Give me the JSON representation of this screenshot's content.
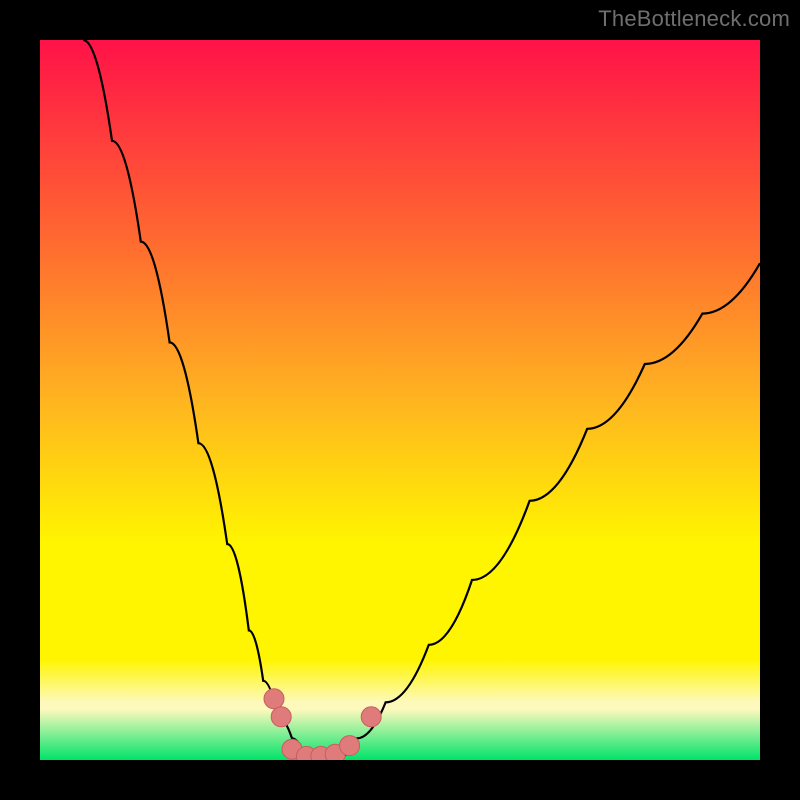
{
  "watermark": {
    "text": "TheBottleneck.com"
  },
  "colors": {
    "frame": "#000000",
    "gradient_top": "#ff1248",
    "gradient_upper_mid": "#ff6a30",
    "gradient_mid": "#ffb420",
    "gradient_lower_mid": "#fff500",
    "gradient_pale": "#fdf9bc",
    "gradient_green": "#00e36a",
    "curve_stroke": "#000000",
    "marker_fill": "#e07b7b",
    "marker_stroke": "#c95d5d"
  },
  "chart_data": {
    "type": "line",
    "title": "",
    "xlabel": "",
    "ylabel": "",
    "xlim": [
      0,
      100
    ],
    "ylim": [
      0,
      100
    ],
    "grid": false,
    "series": [
      {
        "name": "left-branch",
        "x": [
          6,
          10,
          14,
          18,
          22,
          26,
          29,
          31,
          33,
          35,
          37
        ],
        "y": [
          100,
          86,
          72,
          58,
          44,
          30,
          18,
          11,
          6,
          3,
          0
        ]
      },
      {
        "name": "right-branch",
        "x": [
          41,
          44,
          48,
          54,
          60,
          68,
          76,
          84,
          92,
          100
        ],
        "y": [
          0,
          3,
          8,
          16,
          25,
          36,
          46,
          55,
          62,
          69
        ]
      }
    ],
    "markers": [
      {
        "x": 32.5,
        "y": 8.5
      },
      {
        "x": 33.5,
        "y": 6.0
      },
      {
        "x": 35.0,
        "y": 1.5
      },
      {
        "x": 37.0,
        "y": 0.5
      },
      {
        "x": 39.0,
        "y": 0.5
      },
      {
        "x": 41.0,
        "y": 0.8
      },
      {
        "x": 43.0,
        "y": 2.0
      },
      {
        "x": 46.0,
        "y": 6.0
      }
    ],
    "annotations": []
  }
}
